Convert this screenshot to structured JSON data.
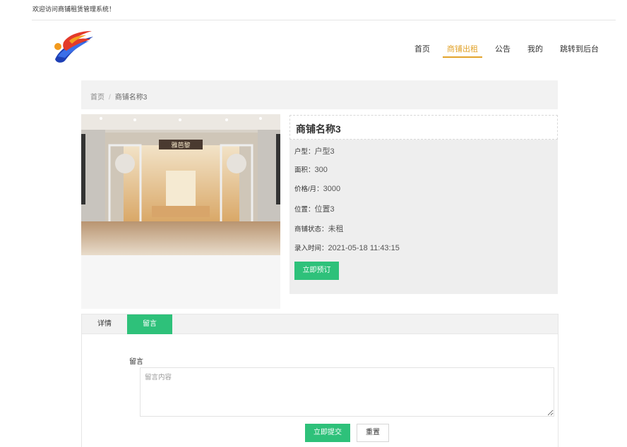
{
  "header": {
    "welcome": "欢迎访问商铺租赁管理系统！"
  },
  "nav": {
    "items": [
      {
        "label": "首页"
      },
      {
        "label": "商铺出租",
        "active": true
      },
      {
        "label": "公告"
      },
      {
        "label": "我的"
      },
      {
        "label": "跳转到后台"
      }
    ]
  },
  "breadcrumb": {
    "home": "首页",
    "separator": "/",
    "current": "商铺名称3"
  },
  "shop": {
    "name": "商铺名称3",
    "photo_sign": "雅芭黎",
    "fields": [
      {
        "label": "户型：",
        "value": "户型3"
      },
      {
        "label": "面积：",
        "value": "300"
      },
      {
        "label": "价格/月：",
        "value": "3000"
      },
      {
        "label": "位置：",
        "value": "位置3"
      },
      {
        "label": "商铺状态：",
        "value": "未租"
      },
      {
        "label": "录入时间：",
        "value": "2021-05-18 11:43:15"
      }
    ],
    "book_label": "立即预订"
  },
  "tabs": {
    "items": [
      {
        "label": "详情"
      },
      {
        "label": "留言",
        "active": true
      }
    ]
  },
  "comment": {
    "label": "留言",
    "placeholder": "留言内容",
    "submit_label": "立即提交",
    "reset_label": "重置"
  },
  "colors": {
    "accent": "#2ec17a",
    "nav_active": "#e2a32b"
  }
}
